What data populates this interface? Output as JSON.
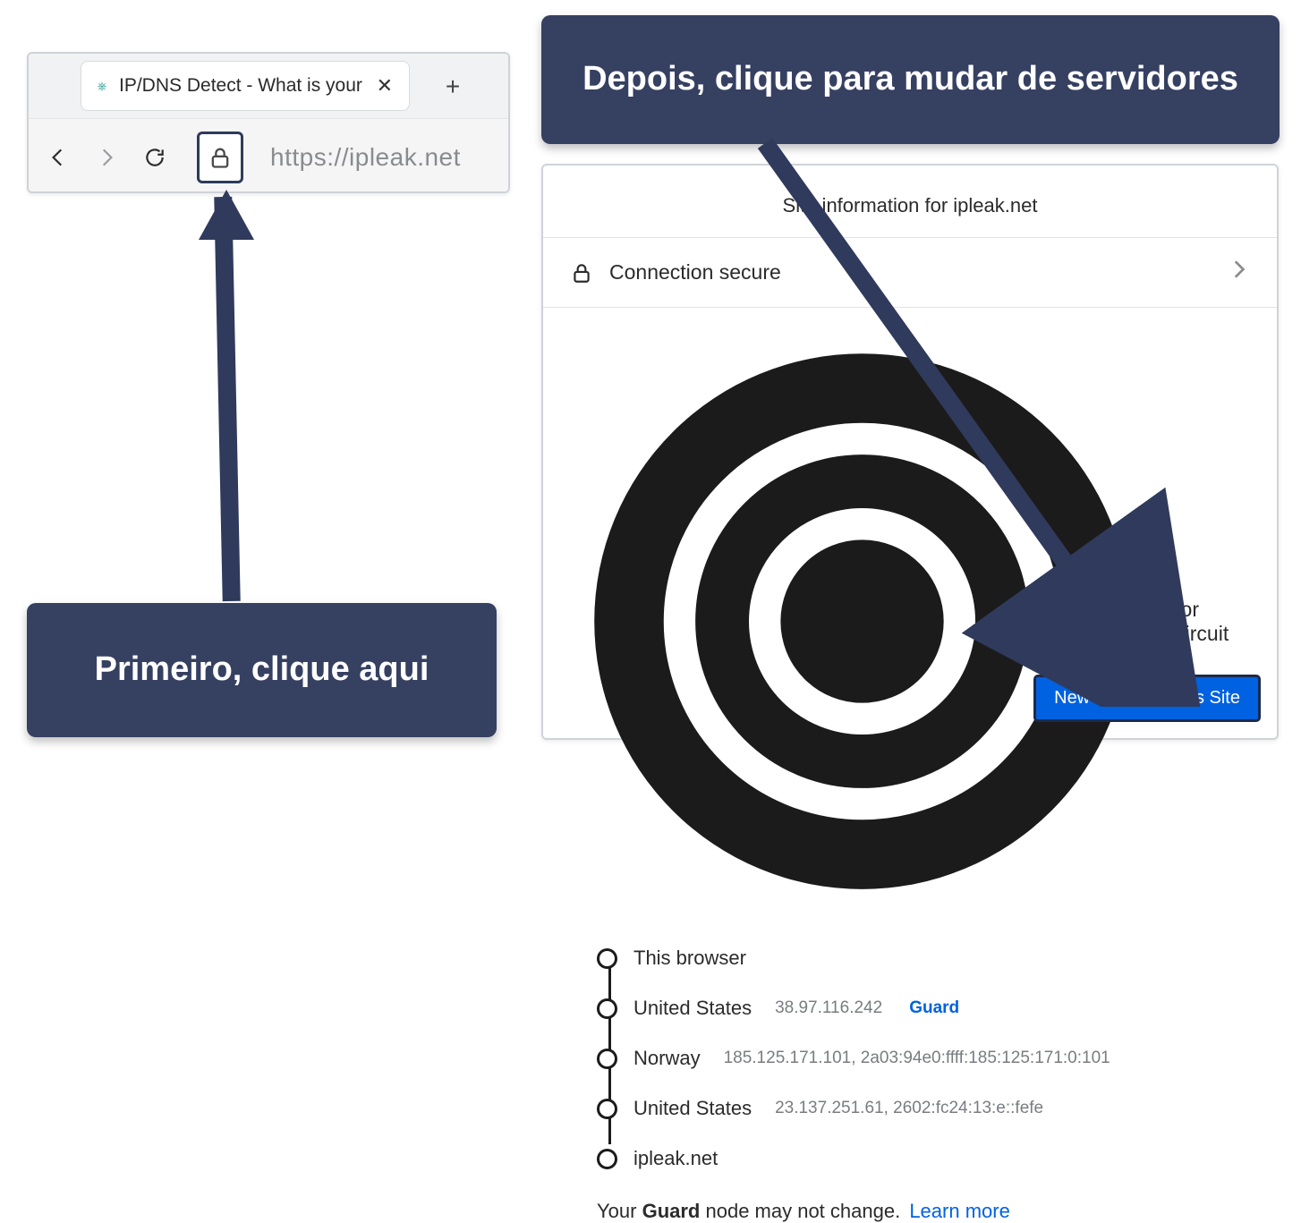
{
  "browser": {
    "tab_title": "IP/DNS Detect - What is your IP,",
    "url": "https://ipleak.net",
    "favicon_glyph": "⎈"
  },
  "popup": {
    "header": "Site information for ipleak.net",
    "connection_label": "Connection secure",
    "tor_label": "Tor Circuit",
    "circuit": [
      {
        "label": "This browser",
        "ip": "",
        "tag": ""
      },
      {
        "label": "United States",
        "ip": "38.97.116.242",
        "tag": "Guard"
      },
      {
        "label": "Norway",
        "ip": "185.125.171.101, 2a03:94e0:ffff:185:125:171:0:101",
        "tag": ""
      },
      {
        "label": "United States",
        "ip": "23.137.251.61, 2602:fc24:13:e::fefe",
        "tag": ""
      },
      {
        "label": "ipleak.net",
        "ip": "",
        "tag": ""
      }
    ],
    "guard_note_pre": "Your ",
    "guard_note_bold": "Guard",
    "guard_note_post": " node may not change. ",
    "learn_more": "Learn more",
    "new_circuit_button": "New Circuit for this Site"
  },
  "callout_bottom": "Primeiro, clique aqui",
  "callout_top": "Depois, clique para mudar de servidores"
}
